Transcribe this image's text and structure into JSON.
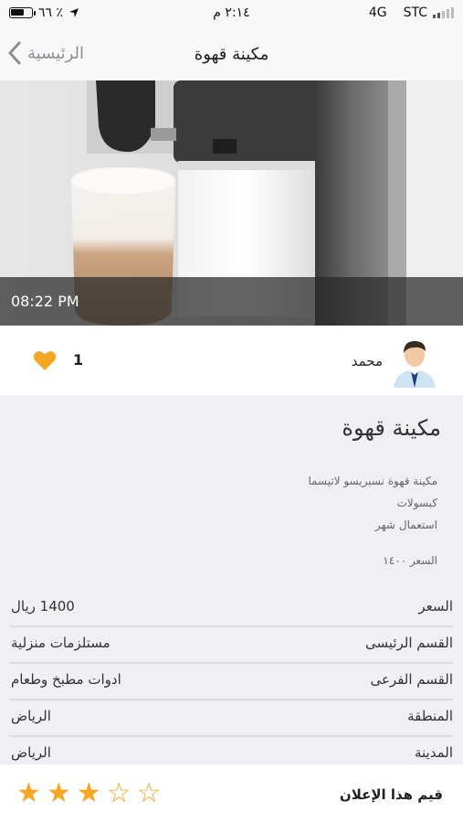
{
  "status_bar": {
    "battery": "٦٦ ٪",
    "battery_level": 0.66,
    "time": "٢:١٤ م",
    "network": "4G",
    "carrier": "STC"
  },
  "nav": {
    "back_label": "الرئيسية",
    "title": "مكينة قهوة"
  },
  "hero": {
    "time": "08:22 PM"
  },
  "user": {
    "name": "محمد",
    "likes": "1"
  },
  "listing": {
    "title": "مكينة قهوة",
    "description": [
      "مكينة قهوة نسبريسو لاتيسما",
      "كبسولات",
      "استعمال شهر"
    ],
    "price_note": "السعر ١٤٠٠"
  },
  "details": [
    {
      "label": "السعر",
      "value": "1400 ريال"
    },
    {
      "label": "القسم الرئيسى",
      "value": "مستلزمات منزلية"
    },
    {
      "label": "القسم الفرعى",
      "value": "ادوات مطبخ وطعام"
    },
    {
      "label": "المنطقة",
      "value": "الرياض"
    },
    {
      "label": "المدينة",
      "value": "الرياض"
    }
  ],
  "rating": {
    "label": "قيم هذا الإعلان",
    "value": 3,
    "max": 5
  },
  "colors": {
    "accent": "#f5a623",
    "overlay": "#2a2a2a"
  },
  "icons": {
    "back": "chevron-left-icon",
    "like": "heart-icon",
    "avatar": "user-avatar",
    "location": "location-arrow-icon"
  }
}
